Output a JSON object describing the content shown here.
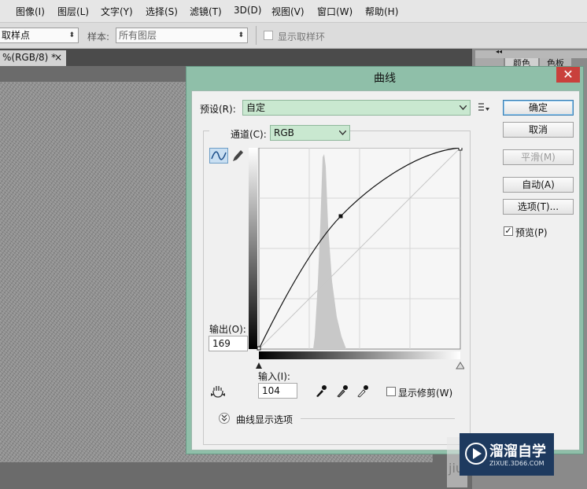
{
  "menubar": {
    "items": [
      "图像(I)",
      "图层(L)",
      "文字(Y)",
      "选择(S)",
      "滤镜(T)",
      "3D(D)",
      "视图(V)",
      "窗口(W)",
      "帮助(H)"
    ]
  },
  "options_bar": {
    "sample_tool_value": "取样点",
    "sample_label": "样本:",
    "sample_value": "所有图层",
    "show_ring_label": "显示取样环"
  },
  "document_tab": {
    "label": "%(RGB/8) *",
    "close": "×"
  },
  "panel_tabs": [
    "颜色",
    "色板"
  ],
  "dialog": {
    "title": "曲线",
    "close_glyph": "✕",
    "preset_label": "预设(R):",
    "preset_value": "自定",
    "channel_label": "通道(C):",
    "channel_value": "RGB",
    "output_label": "输出(O):",
    "output_value": "169",
    "input_label": "输入(I):",
    "input_value": "104",
    "show_clipping_label": "显示修剪(W)",
    "curve_display_options": "曲线显示选项",
    "buttons": {
      "ok": "确定",
      "cancel": "取消",
      "smooth": "平滑(M)",
      "auto": "自动(A)",
      "options": "选项(T)..."
    },
    "preview_label": "预览(P)",
    "preview_checked": true,
    "curve": {
      "control_point": {
        "input": 104,
        "output": 169
      },
      "range": [
        0,
        255
      ]
    }
  },
  "watermark": {
    "brand": "溜溜自学",
    "url": "ZIXUE.3D66.COM",
    "partial_text": "jiu"
  },
  "colors": {
    "dialog_frame": "#8fbfa9",
    "close_button": "#c9403c",
    "preset_field": "#c9e8d0",
    "watermark_bg": "#1e3a5f"
  }
}
